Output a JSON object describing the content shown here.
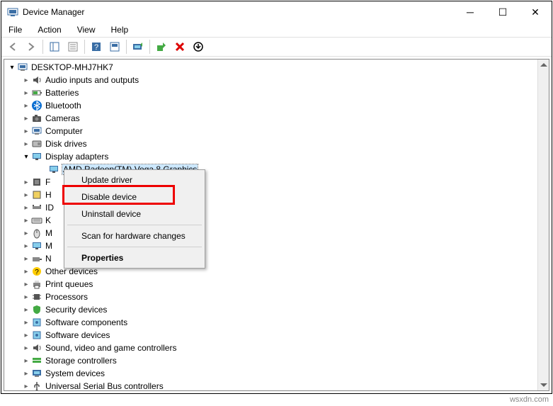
{
  "window": {
    "title": "Device Manager"
  },
  "menu": {
    "file": "File",
    "action": "Action",
    "view": "View",
    "help": "Help"
  },
  "root": "DESKTOP-MHJ7HK7",
  "categories": [
    {
      "name": "Audio inputs and outputs",
      "icon": "audio"
    },
    {
      "name": "Batteries",
      "icon": "battery"
    },
    {
      "name": "Bluetooth",
      "icon": "bluetooth"
    },
    {
      "name": "Cameras",
      "icon": "camera"
    },
    {
      "name": "Computer",
      "icon": "computer"
    },
    {
      "name": "Disk drives",
      "icon": "disk"
    },
    {
      "name": "Display adapters",
      "icon": "display",
      "open": true,
      "children": [
        {
          "name": "AMD Radeon(TM) Vega 8 Graphics",
          "icon": "display",
          "selected": true
        }
      ]
    },
    {
      "name": "F",
      "icon": "firmware"
    },
    {
      "name": "H",
      "icon": "hid"
    },
    {
      "name": "ID",
      "icon": "ide"
    },
    {
      "name": "K",
      "icon": "keyboard"
    },
    {
      "name": "M",
      "icon": "mouse"
    },
    {
      "name": "M",
      "icon": "display"
    },
    {
      "name": "N",
      "icon": "network"
    },
    {
      "name": "Other devices",
      "icon": "other"
    },
    {
      "name": "Print queues",
      "icon": "printer"
    },
    {
      "name": "Processors",
      "icon": "cpu"
    },
    {
      "name": "Security devices",
      "icon": "security"
    },
    {
      "name": "Software components",
      "icon": "software"
    },
    {
      "name": "Software devices",
      "icon": "software"
    },
    {
      "name": "Sound, video and game controllers",
      "icon": "audio"
    },
    {
      "name": "Storage controllers",
      "icon": "storage"
    },
    {
      "name": "System devices",
      "icon": "system"
    },
    {
      "name": "Universal Serial Bus controllers",
      "icon": "usb"
    }
  ],
  "context_menu": {
    "update": "Update driver",
    "disable": "Disable device",
    "uninstall": "Uninstall device",
    "scan": "Scan for hardware changes",
    "properties": "Properties"
  },
  "watermark": "wsxdn.com"
}
